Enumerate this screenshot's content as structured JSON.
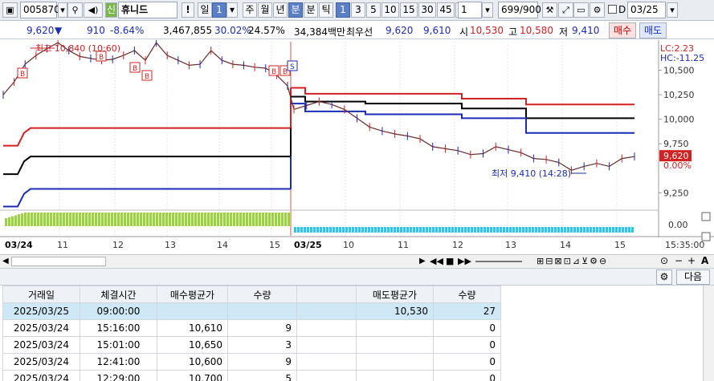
{
  "toolbar": {
    "code": "005870",
    "name": "휴니드",
    "name_badge": "신",
    "warn": "!",
    "period_day": "일",
    "period_num": "1",
    "p_week": "주",
    "p_month": "월",
    "p_year": "년",
    "p_min": "분",
    "p_tick": "초",
    "p_tk": "틱",
    "intervals": [
      "1",
      "3",
      "5",
      "10",
      "15",
      "30",
      "45",
      "60"
    ],
    "count": "1",
    "page": "699/900",
    "d_label": "D",
    "date": "03/25"
  },
  "quote": {
    "price": "9,620",
    "dir": "▼",
    "change": "910",
    "rate": "-8.64%",
    "volume": "3,467,855",
    "ratio1": "30.02%",
    "ratio2": "24.57%",
    "amount": "34,384백만",
    "best_label": "최우선",
    "ask": "9,620",
    "bid": "9,610",
    "open_label": "시",
    "open": "10,530",
    "high_label": "고",
    "high": "10,580",
    "low_label": "저",
    "low": "9,410",
    "buy": "매수",
    "sell": "매도"
  },
  "chart_data": {
    "type": "line",
    "title": "",
    "x_sessions": [
      {
        "date": "03/24",
        "hours": [
          "11",
          "12",
          "13",
          "14",
          "15"
        ]
      },
      {
        "date": "03/25",
        "hours": [
          "10",
          "11",
          "12",
          "13",
          "14",
          "15"
        ]
      }
    ],
    "price_axis": {
      "ticks": [
        "10,500",
        "10,250",
        "10,000",
        "9,750",
        "9,250"
      ],
      "range": [
        9090,
        10790
      ]
    },
    "indicator_axis": {
      "tick": "0.00"
    },
    "time_label": "15:35:00",
    "lc_label": "LC:2.23",
    "hc_label": "HC:-11.25",
    "current_price": "9,620",
    "current_rate": "0.00%",
    "high_annotation": "최고 10,840 (10:60)",
    "low_annotation": "최저 9,410 (14:28)",
    "buy_markers": [
      "B",
      "B",
      "B",
      "B",
      "B",
      "B"
    ],
    "sell_marker": "S",
    "colors": {
      "up": "#d32020",
      "down": "#1a2bb8",
      "band_mid": "#000000",
      "vol_up": "#9bd33a",
      "vol_down": "#29c6e6"
    },
    "bands": {
      "day1": {
        "upper": 9910,
        "middle": 9620,
        "lower": 9290
      },
      "day2_upper": [
        10320,
        10260,
        10260,
        10210,
        10150,
        10150
      ],
      "day2_middle": [
        10230,
        10180,
        10160,
        10110,
        10010,
        10010
      ],
      "day2_lower": [
        10160,
        10080,
        10050,
        10010,
        9860,
        9860
      ]
    },
    "price_series": [
      10250,
      10380,
      10560,
      10650,
      10720,
      10780,
      10700,
      10640,
      10620,
      10600,
      10610,
      10650,
      10700,
      10600,
      10780,
      10650,
      10600,
      10550,
      10560,
      10700,
      10600,
      10560,
      10550,
      10530,
      10520,
      10450,
      10340,
      10100,
      10140,
      10180,
      10150,
      10100,
      10010,
      9920,
      9880,
      9850,
      9830,
      9800,
      9720,
      9700,
      9680,
      9640,
      9650,
      9720,
      9690,
      9660,
      9600,
      9590,
      9560,
      9480,
      9520,
      9550,
      9520,
      9600,
      9620
    ]
  },
  "orders": {
    "headers": [
      "거래일",
      "체결시간",
      "매수평균가",
      "수량",
      "",
      "매도평균가",
      "수량"
    ],
    "rows": [
      [
        "2025/03/25",
        "09:00:00",
        "",
        "",
        "",
        "10,530",
        "27"
      ],
      [
        "2025/03/24",
        "15:16:00",
        "10,610",
        "9",
        "",
        "",
        "0"
      ],
      [
        "2025/03/24",
        "15:01:00",
        "10,650",
        "3",
        "",
        "",
        "0"
      ],
      [
        "2025/03/24",
        "12:41:00",
        "10,600",
        "9",
        "",
        "",
        "0"
      ],
      [
        "2025/03/24",
        "12:29:00",
        "10,700",
        "5",
        "",
        "",
        "0"
      ]
    ],
    "next": "다음"
  }
}
